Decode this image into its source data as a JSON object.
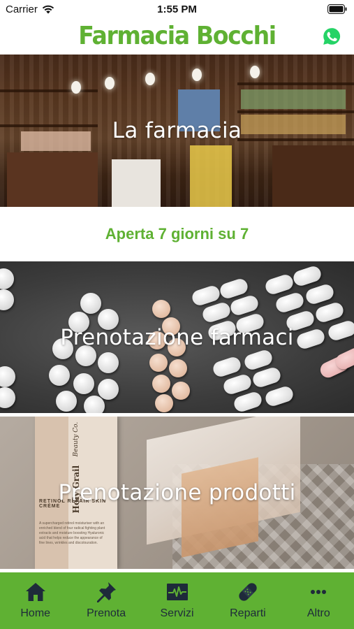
{
  "status_bar": {
    "carrier": "Carrier",
    "time": "1:55 PM"
  },
  "header": {
    "title": "Farmacia Bocchi",
    "whatsapp_icon": "whatsapp-icon"
  },
  "banners": [
    {
      "caption": "La farmacia"
    },
    {
      "caption": "Prenotazione farmaci"
    },
    {
      "caption": "Prenotazione prodotti"
    }
  ],
  "hours_text": "Aperta 7 giorni su 7",
  "product_box": {
    "brand": "Holy Grail",
    "brand_sub": "Beauty Co.",
    "title": "RETINOL REPAIR SKIN CRÈME",
    "description": "A supercharged retinol moisturiser with an enriched blend of four radical fighting plant extracts and moisture boosting Hyaluronic acid that helps reduce the appearance of fine lines, wrinkles and discolouration."
  },
  "tabs": [
    {
      "label": "Home",
      "icon": "home-icon"
    },
    {
      "label": "Prenota",
      "icon": "pin-icon"
    },
    {
      "label": "Servizi",
      "icon": "heartbeat-icon"
    },
    {
      "label": "Reparti",
      "icon": "bandage-icon"
    },
    {
      "label": "Altro",
      "icon": "more-icon"
    }
  ],
  "colors": {
    "brand_green": "#5fb133",
    "tab_icon": "#1e2a3a",
    "whatsapp": "#25d366"
  }
}
